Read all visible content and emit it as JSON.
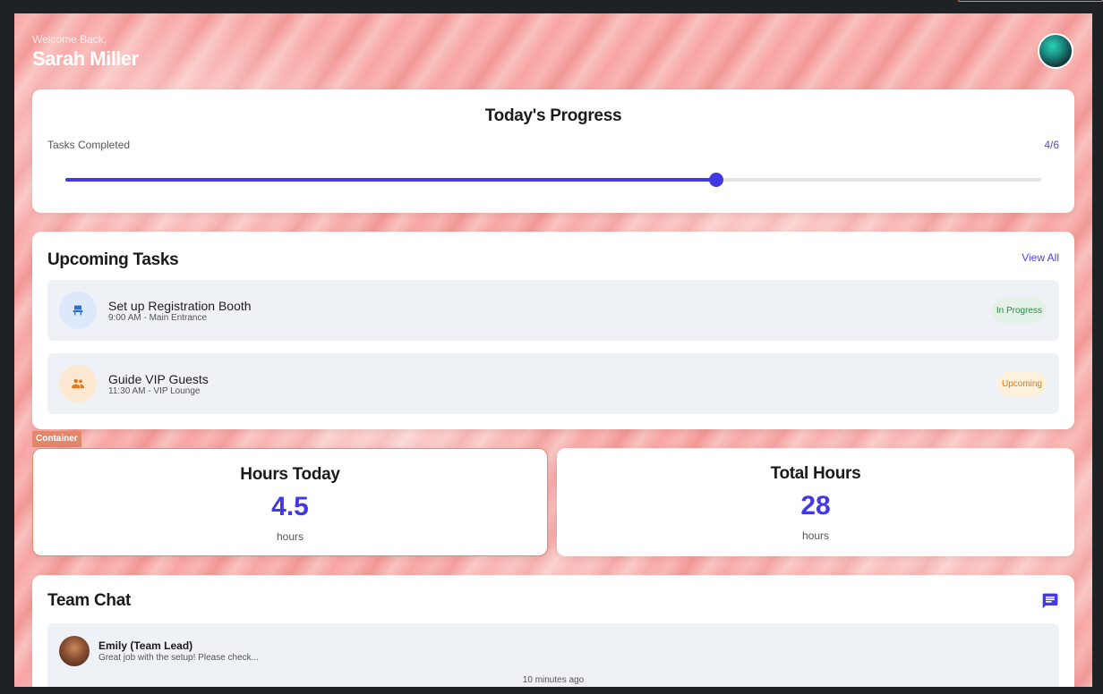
{
  "header": {
    "welcome": "Welcome Back,",
    "user_name": "Sarah Miller",
    "avatar_icon": "user-avatar"
  },
  "progress": {
    "title": "Today's Progress",
    "label": "Tasks Completed",
    "count_text": "4/6",
    "completed": 4,
    "total": 6,
    "accent": "#4338e6"
  },
  "upcoming": {
    "title": "Upcoming Tasks",
    "view_all": "View All",
    "tasks": [
      {
        "title": "Set up Registration Booth",
        "subtitle": "9:00 AM - Main Entrance",
        "status": "In Progress",
        "icon": "chair-icon"
      },
      {
        "title": "Guide VIP Guests",
        "subtitle": "11:30 AM - VIP Lounge",
        "status": "Upcoming",
        "icon": "group-icon"
      }
    ]
  },
  "container_tag": "Container",
  "stats": {
    "hours_today": {
      "title": "Hours Today",
      "value": "4.5",
      "unit": "hours"
    },
    "total_hours": {
      "title": "Total Hours",
      "value": "28",
      "unit": "hours"
    }
  },
  "chat": {
    "title": "Team Chat",
    "icon": "message-icon",
    "messages": [
      {
        "name": "Emily (Team Lead)",
        "text": "Great job with the setup! Please check...",
        "time": "10 minutes ago"
      }
    ]
  }
}
